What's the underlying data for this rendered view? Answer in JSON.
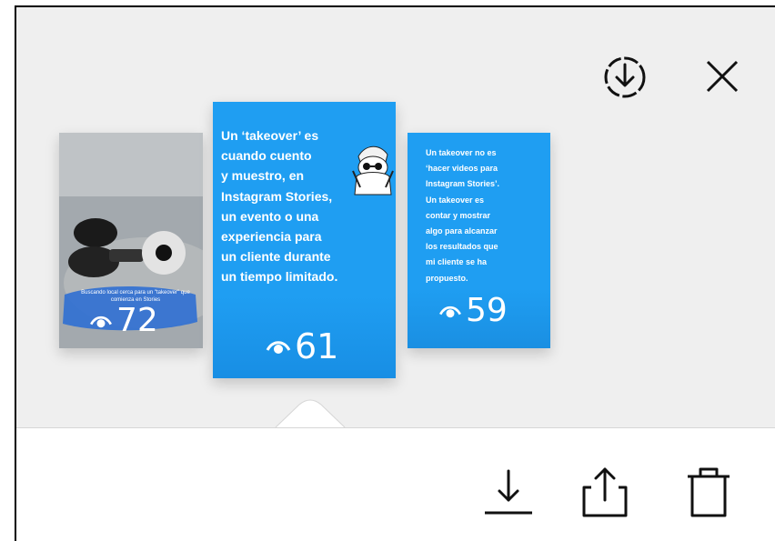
{
  "toolbar": {
    "save_icon": "circle-download-icon",
    "close_icon": "close-icon"
  },
  "stories": [
    {
      "caption": "Buscando local cerca para un \"takeover\" que comienza en Stories",
      "views": "72",
      "view_icon": "eye-icon"
    },
    {
      "text_lines": [
        "Un ‘takeover’ es",
        "cuando cuento",
        "y muestro, en",
        "Instagram Stories,",
        "un evento o una",
        "experiencia para",
        "un cliente durante",
        "un tiempo limitado."
      ],
      "views": "61",
      "view_icon": "eye-icon"
    },
    {
      "text_lines": [
        "Un takeover no es",
        "‘hacer videos para",
        "Instagram Stories’.",
        "Un takeover es",
        "contar y mostrar",
        "algo para alcanzar",
        "los resultados que",
        "mi cliente se ha",
        "propuesto."
      ],
      "views": "59",
      "view_icon": "eye-icon"
    }
  ],
  "actions": {
    "download_icon": "download-icon",
    "share_icon": "share-icon",
    "delete_icon": "trash-icon"
  }
}
